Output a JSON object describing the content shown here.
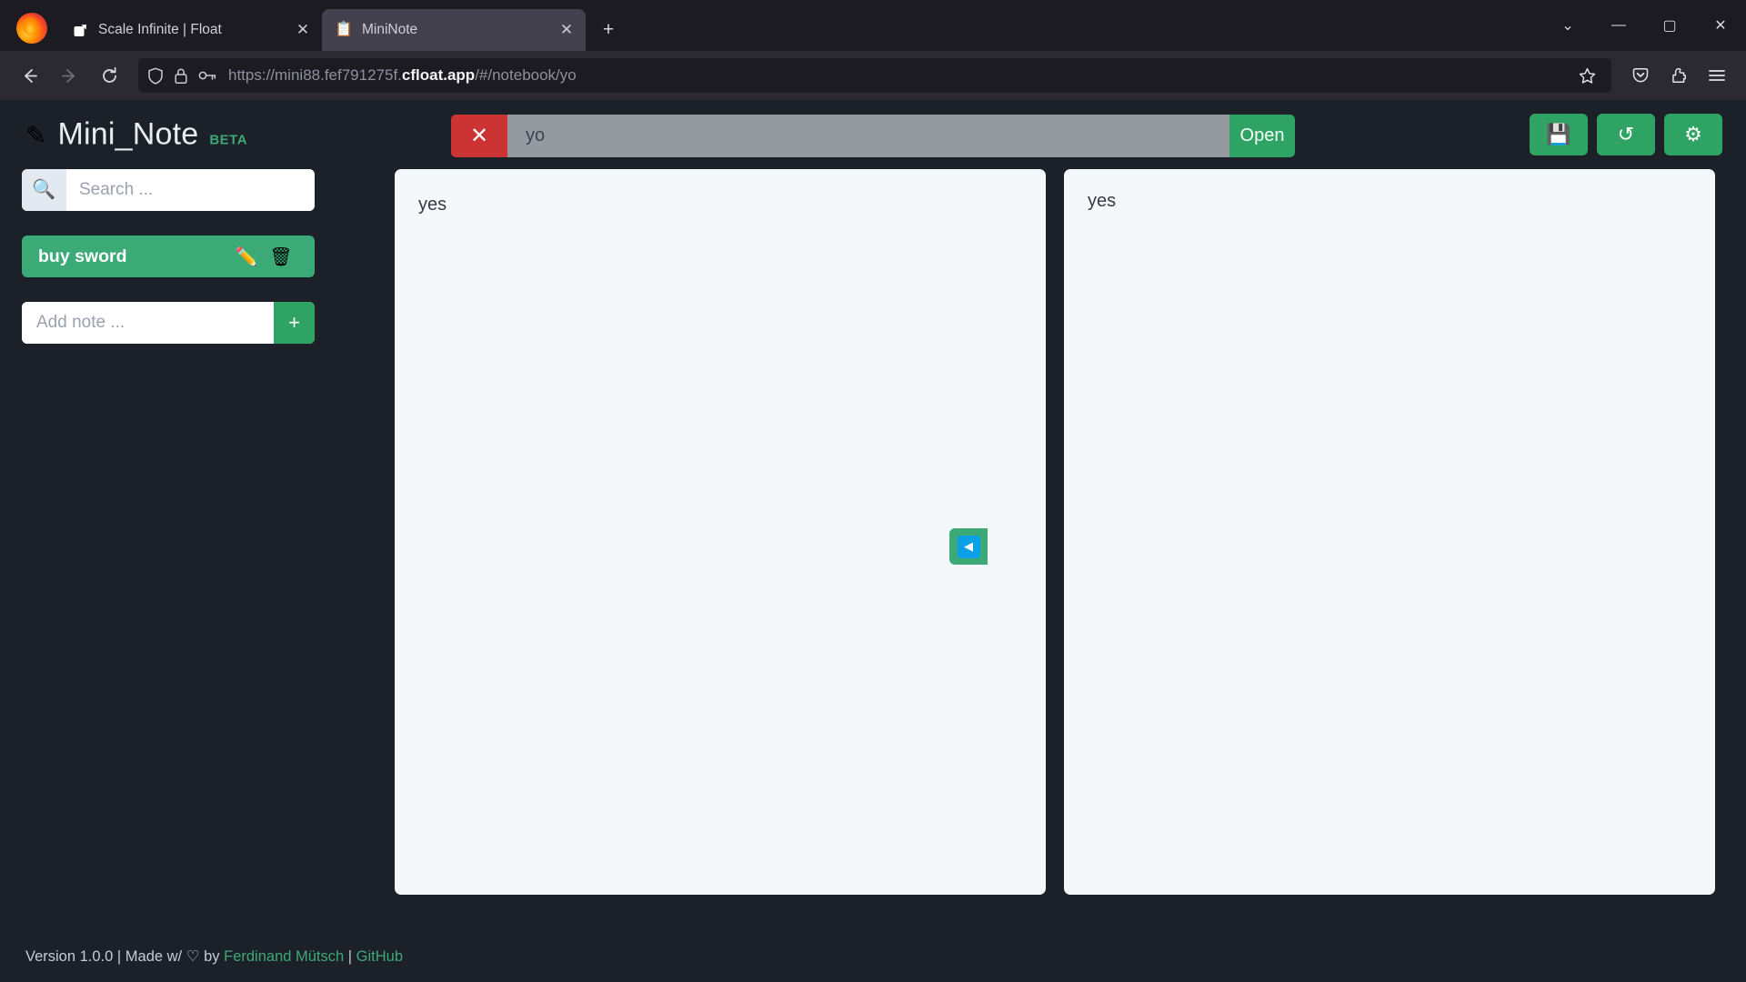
{
  "browser": {
    "tabs": [
      {
        "title": "Scale Infinite | Float",
        "favicon": "arrow-box-icon",
        "active": false
      },
      {
        "title": "MiniNote",
        "favicon": "notepad-icon",
        "active": true
      }
    ],
    "new_tab_label": "+",
    "window_controls": {
      "list_all_tabs": "⌄",
      "minimize": "—",
      "maximize": "▢",
      "close": "✕"
    },
    "nav": {
      "back": "back-icon",
      "forward": "forward-icon",
      "reload": "reload-icon"
    },
    "url": {
      "prefix": "https://mini88.fef791275f.",
      "domain": "cfloat.app",
      "suffix": "/#/notebook/yo",
      "full": "https://mini88.fef791275f.cfloat.app/#/notebook/yo"
    },
    "toolbar_icons": {
      "shield": "shield-icon",
      "lock": "lock-icon",
      "key": "key-icon",
      "bookmark_star": "★",
      "pocket": "pocket-icon",
      "extensions": "extensions-icon",
      "menu": "≡"
    }
  },
  "app": {
    "brand": {
      "icon": "✎",
      "name": "Mini_Note",
      "badge": "BETA"
    },
    "openbar": {
      "clear_label": "✕",
      "value": "yo",
      "open_label": "Open"
    },
    "header_actions": [
      {
        "name": "save",
        "icon": "💾"
      },
      {
        "name": "reload",
        "icon": "↺"
      },
      {
        "name": "settings",
        "icon": "⚙"
      }
    ],
    "sidebar": {
      "search_placeholder": "Search ...",
      "search_value": "",
      "search_icon": "🔍",
      "notes": [
        {
          "title": "buy sword",
          "edit_icon": "✏️",
          "delete_icon": "🗑"
        }
      ],
      "add_note_placeholder": "Add note ...",
      "add_note_value": "",
      "add_button_label": "+"
    },
    "editor": {
      "markdown": "yes",
      "preview": "yes",
      "collapse_icon": "◀"
    },
    "footer": {
      "version_text": "Version 1.0.0 | Made w/ ",
      "heart": "♡",
      "by_text": " by ",
      "author": "Ferdinand Mütsch",
      "separator": " | ",
      "github": "GitHub"
    }
  },
  "colors": {
    "accent_green": "#2fa364",
    "note_green": "#3caa76",
    "danger_red": "#cc3333",
    "app_bg": "#1c2028",
    "pane_bg": "#f5f8fb",
    "blue": "#0b9fe8"
  }
}
